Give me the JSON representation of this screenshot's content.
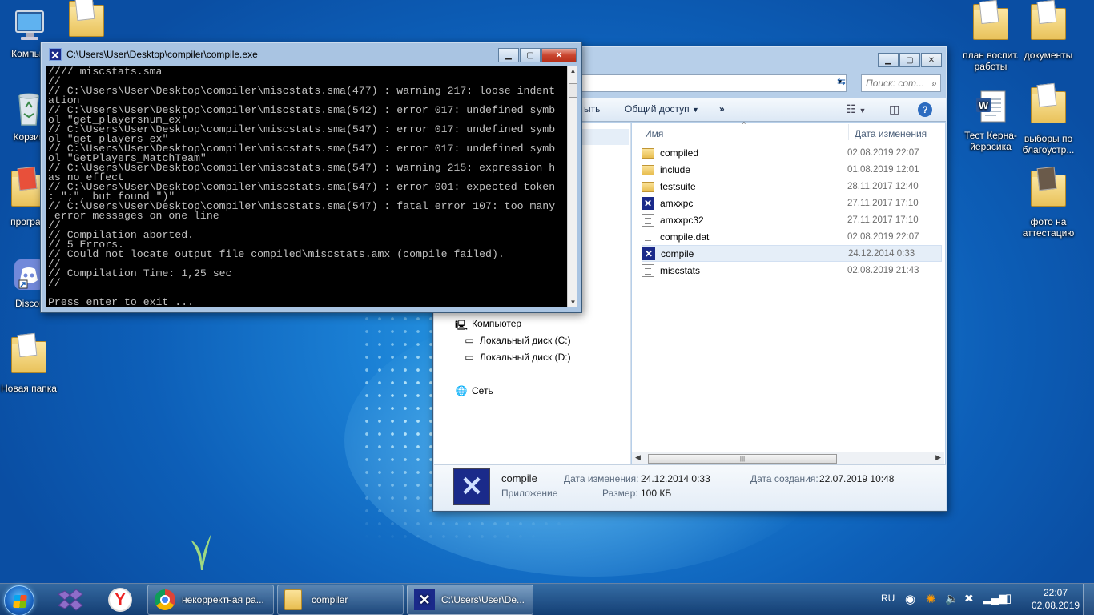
{
  "desktop": {
    "icons_left": [
      {
        "label": "Компью",
        "icon": "computer-icon"
      },
      {
        "label": "Корзин",
        "icon": "recycle-bin-icon"
      },
      {
        "label": "програм",
        "icon": "program-icon"
      },
      {
        "label": "Discor",
        "icon": "discord-icon"
      },
      {
        "label": "Новая папка",
        "icon": "folder-icon"
      }
    ],
    "icons_right": [
      {
        "label": "план воспит. работы",
        "icon": "folder-icon"
      },
      {
        "label": "документы",
        "icon": "folder-icon"
      },
      {
        "label": "Тест Керна-йерасика",
        "icon": "word-document-icon"
      },
      {
        "label": "выборы по благоустр...",
        "icon": "folder-icon"
      },
      {
        "label": "фото на аттестацию",
        "icon": "folder-icon"
      }
    ]
  },
  "console": {
    "title": "C:\\Users\\User\\Desktop\\compiler\\compile.exe",
    "lines": [
      "//// miscstats.sma",
      "//",
      "// C:\\Users\\User\\Desktop\\compiler\\miscstats.sma(477) : warning 217: loose indent",
      "ation",
      "// C:\\Users\\User\\Desktop\\compiler\\miscstats.sma(542) : error 017: undefined symb",
      "ol \"get_playersnum_ex\"",
      "// C:\\Users\\User\\Desktop\\compiler\\miscstats.sma(547) : error 017: undefined symb",
      "ol \"get_players_ex\"",
      "// C:\\Users\\User\\Desktop\\compiler\\miscstats.sma(547) : error 017: undefined symb",
      "ol \"GetPlayers_MatchTeam\"",
      "// C:\\Users\\User\\Desktop\\compiler\\miscstats.sma(547) : warning 215: expression h",
      "as no effect",
      "// C:\\Users\\User\\Desktop\\compiler\\miscstats.sma(547) : error 001: expected token",
      ": \";\", but found \")\"",
      "// C:\\Users\\User\\Desktop\\compiler\\miscstats.sma(547) : fatal error 107: too many",
      " error messages on one line",
      "//",
      "// Compilation aborted.",
      "// 5 Errors.",
      "// Could not locate output file compiled\\miscstats.amx (compile failed).",
      "//",
      "// Compilation Time: 1,25 sec",
      "// ----------------------------------------",
      "",
      "Press enter to exit ..."
    ],
    "content": ""
  },
  "explorer": {
    "search_placeholder": "Поиск: com...",
    "toolbar": {
      "partial_label": "ыть",
      "share_label": "Общий доступ",
      "more_label": "»"
    },
    "columns": {
      "name": "Имя",
      "date": "Дата изменения"
    },
    "files": [
      {
        "name": "compiled",
        "date": "02.08.2019 22:07",
        "type": "folder"
      },
      {
        "name": "include",
        "date": "01.08.2019 12:01",
        "type": "folder"
      },
      {
        "name": "testsuite",
        "date": "28.11.2017 12:40",
        "type": "folder"
      },
      {
        "name": "amxxpc",
        "date": "27.11.2017 17:10",
        "type": "app"
      },
      {
        "name": "amxxpc32",
        "date": "27.11.2017 17:10",
        "type": "doc"
      },
      {
        "name": "compile.dat",
        "date": "02.08.2019 22:07",
        "type": "doc"
      },
      {
        "name": "compile",
        "date": "24.12.2014 0:33",
        "type": "app"
      },
      {
        "name": "miscstats",
        "date": "02.08.2019 21:43",
        "type": "doc"
      }
    ],
    "nav": {
      "computer": "Компьютер",
      "disk_c": "Локальный диск (C:)",
      "disk_d": "Локальный диск (D:)",
      "network": "Сеть"
    },
    "details": {
      "name": "compile",
      "type": "Приложение",
      "modified_label": "Дата изменения:",
      "modified_value": "24.12.2014 0:33",
      "created_label": "Дата создания:",
      "created_value": "22.07.2019 10:48",
      "size_label": "Размер:",
      "size_value": "100 КБ"
    }
  },
  "taskbar": {
    "tasks": [
      {
        "label": "некорректная ра...",
        "icon": "chrome-icon"
      },
      {
        "label": "compiler",
        "icon": "folder-icon"
      },
      {
        "label": "C:\\Users\\User\\De...",
        "icon": "compile-icon"
      }
    ],
    "lang": "RU",
    "time": "22:07",
    "date": "02.08.2019"
  }
}
